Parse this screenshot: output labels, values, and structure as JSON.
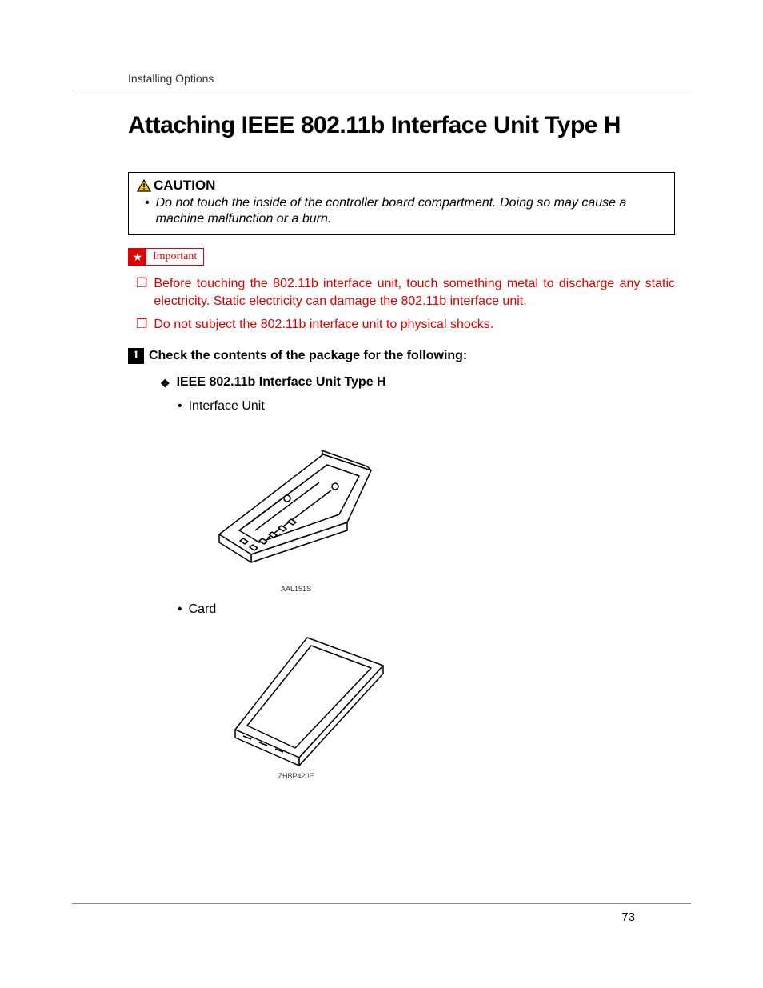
{
  "header": {
    "section": "Installing Options"
  },
  "title": "Attaching IEEE 802.11b Interface Unit Type H",
  "caution": {
    "label": "CAUTION",
    "text": "Do not touch the inside of the controller board compartment. Doing so may cause a machine malfunction or a burn."
  },
  "important": {
    "label": "Important",
    "items": [
      "Before touching the 802.11b interface unit, touch something metal to discharge any static electricity. Static electricity can damage the 802.11b interface unit.",
      "Do not subject the 802.11b interface unit to physical shocks."
    ]
  },
  "step1": {
    "number": "1",
    "text": "Check the contents of the package for the following:"
  },
  "contents": {
    "heading": "IEEE 802.11b Interface Unit Type H",
    "items": [
      {
        "label": "Interface Unit",
        "figure_code": "AAL151S"
      },
      {
        "label": "Card",
        "figure_code": "ZHBP420E"
      }
    ]
  },
  "page_number": "73"
}
